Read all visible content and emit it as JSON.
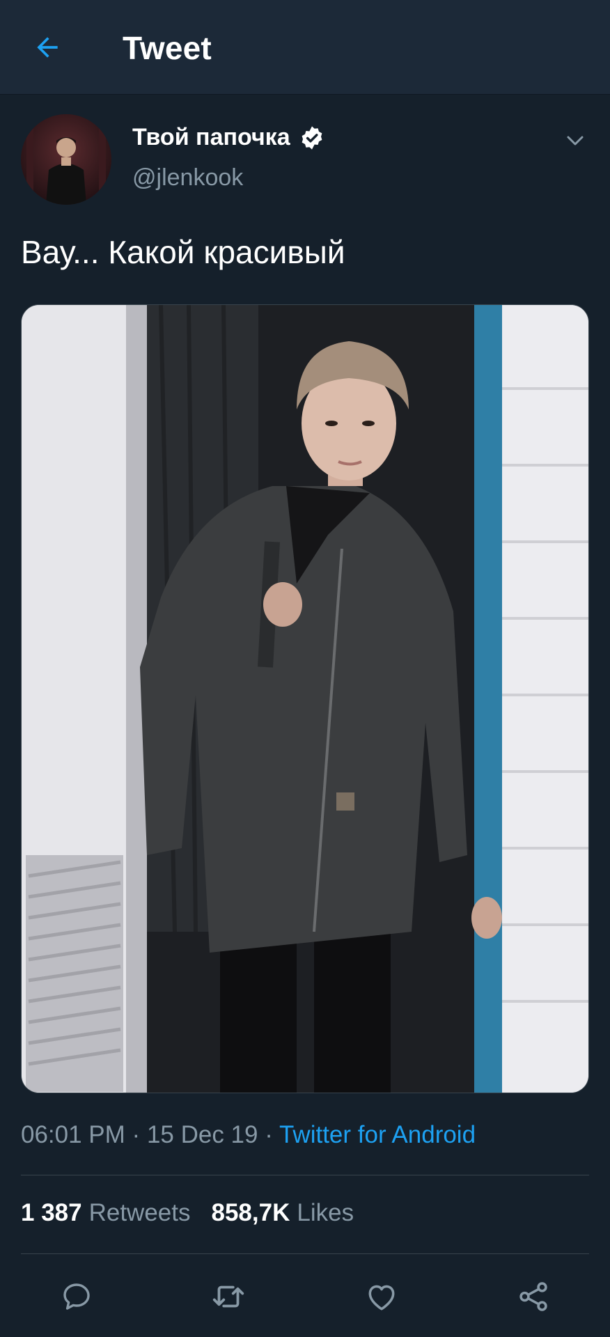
{
  "header": {
    "title": "Tweet"
  },
  "tweet": {
    "author_name": "Твой папочка",
    "author_handle": "@jlenkook",
    "text": "Вау... Какой красивый",
    "time": "06:01 PM",
    "date": "15 Dec 19",
    "source": "Twitter for Android",
    "retweets_count": "1 387",
    "retweets_label": "Retweets",
    "likes_count": "858,7K",
    "likes_label": "Likes"
  },
  "icons": {
    "back": "arrow-left-icon",
    "verified": "verified-badge-icon",
    "more": "chevron-down-icon",
    "reply": "reply-icon",
    "retweet": "retweet-icon",
    "like": "heart-icon",
    "share": "share-icon"
  },
  "colors": {
    "background": "#15202b",
    "header": "#1c2938",
    "accent": "#1da1f2",
    "secondary_text": "#8899a6",
    "divider": "#38444d"
  }
}
